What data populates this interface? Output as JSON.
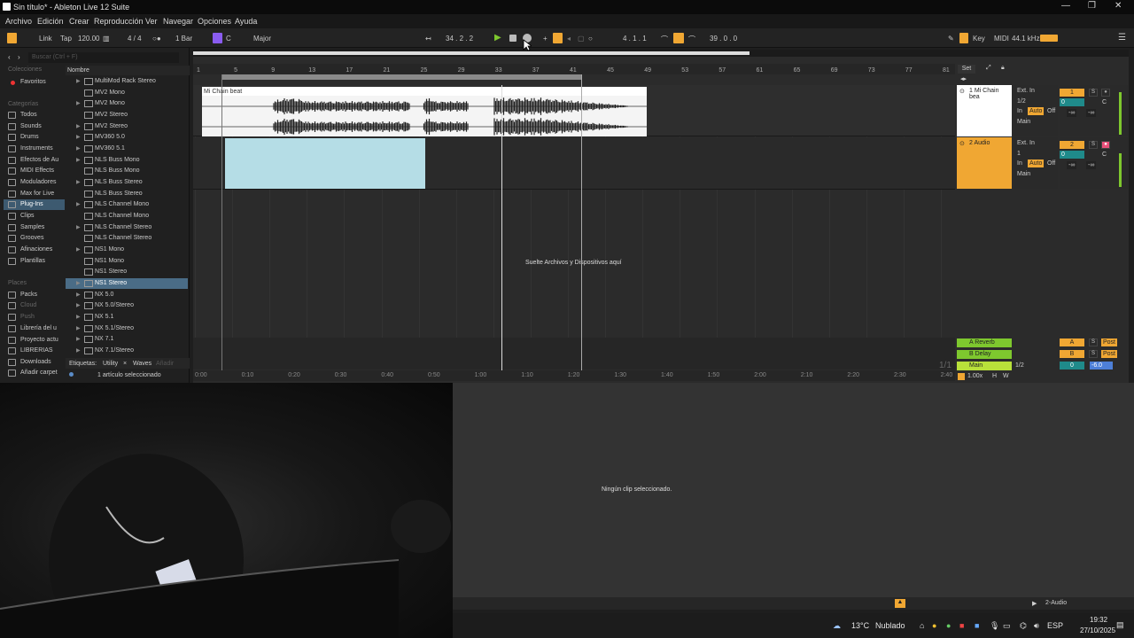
{
  "window": {
    "title": "Sin título* - Ableton Live 12 Suite",
    "minimize": "—",
    "restore": "❐",
    "close": "✕"
  },
  "menu": [
    "Archivo",
    "Edición",
    "Crear",
    "Reproducción",
    "Ver",
    "Navegar",
    "Opciones",
    "Ayuda"
  ],
  "control": {
    "link": "Link",
    "tap": "Tap",
    "tempo": "120.00",
    "signature": "4 / 4",
    "quantize": "1 Bar",
    "key": "C",
    "scale": "Major",
    "position": "34 .  2 .  2",
    "loop_start": "4 .  1 .  1",
    "loop_length": "39 .  0 .  0",
    "key_btn": "Key",
    "midi_btn": "MIDI",
    "sample_rate": "44.1 kHz"
  },
  "browser": {
    "search_placeholder": "Buscar (Ctrl + F)",
    "collections_header": "Colecciones",
    "favorites": "Favoritos",
    "categories_header": "Categorías",
    "categories": [
      "Todos",
      "Sounds",
      "Drums",
      "Instruments",
      "Efectos de Au",
      "MIDI Effects",
      "Moduladores",
      "Max for Live",
      "Plug-Ins",
      "Clips",
      "Samples",
      "Grooves",
      "Afinaciones",
      "Plantillas"
    ],
    "places_header": "Places",
    "places": [
      "Packs",
      "Cloud",
      "Push",
      "Librería del u",
      "Proyecto actu",
      "LIBRERIAS",
      "Downloads",
      "Añadir carpet"
    ],
    "name_header": "Nombre",
    "files": [
      "MultiMod Rack Stereo",
      "MV2 Mono",
      "MV2 Mono",
      "MV2 Stereo",
      "MV2 Stereo",
      "MV360 5.0",
      "MV360 5.1",
      "NLS Buss Mono",
      "NLS Buss Mono",
      "NLS Buss Stereo",
      "NLS Buss Stereo",
      "NLS Channel Mono",
      "NLS Channel Mono",
      "NLS Channel Stereo",
      "NLS Channel Stereo",
      "NS1 Mono",
      "NS1 Mono",
      "NS1 Stereo",
      "NS1 Stereo",
      "NX 5.0",
      "NX 5.0/Stereo",
      "NX 5.1",
      "NX 5.1/Stereo",
      "NX 7.1",
      "NX 7.1/Stereo"
    ],
    "tags_label": "Etiquetas:",
    "tag_utility": "Utility",
    "tag_waves": "Waves",
    "tag_add": "Añadir",
    "status": "1 artículo seleccionado"
  },
  "arrangement": {
    "bar_numbers": [
      "1",
      "5",
      "9",
      "13",
      "17",
      "21",
      "25",
      "29",
      "33",
      "37",
      "41",
      "45",
      "49",
      "53",
      "57",
      "61",
      "65",
      "69",
      "73",
      "77",
      "81"
    ],
    "time_labels": [
      "0:00",
      "0:10",
      "0:20",
      "0:30",
      "0:40",
      "0:50",
      "1:00",
      "1:10",
      "1:20",
      "1:30",
      "1:40",
      "1:50",
      "2:00",
      "2:10",
      "2:20",
      "2:30",
      "2:40"
    ],
    "clip_name": "Mi Chain beat",
    "drop_hint": "Suelte Archivos y Dispositivos aquí",
    "set_label": "Set",
    "page_count": "1/1",
    "zoom": "1.00x"
  },
  "tracks": [
    {
      "name": "1 Mi Chain bea",
      "input": "Ext. In",
      "channel": "1/2",
      "monitor_in": "In",
      "monitor_auto": "Auto",
      "monitor_off": "Off",
      "output": "Main",
      "number": "1",
      "solo": "S",
      "volume": "0",
      "pan": "C",
      "send_a": "-∞",
      "send_b": "-∞",
      "color": "#ffffff"
    },
    {
      "name": "2 Audio",
      "input": "Ext. In",
      "channel": "1",
      "monitor_in": "In",
      "monitor_auto": "Auto",
      "monitor_off": "Off",
      "output": "Main",
      "number": "2",
      "solo": "S",
      "volume": "0",
      "pan": "C",
      "send_a": "-∞",
      "send_b": "-∞",
      "color": "#f0a733"
    }
  ],
  "returns": [
    {
      "name": "A Reverb",
      "letter": "A",
      "solo": "S",
      "post": "Post"
    },
    {
      "name": "B Delay",
      "letter": "B",
      "solo": "S",
      "post": "Post"
    },
    {
      "name": "Main",
      "output": "1/2",
      "volume": "0",
      "meter": "-6.0"
    }
  ],
  "detail": {
    "empty": "Ningún clip seleccionado.",
    "track": "2-Audio"
  },
  "taskbar": {
    "temperature": "13°C",
    "weather": "Nublado",
    "lang": "ESP",
    "time": "19:32",
    "date": "27/10/2025"
  },
  "colors": {
    "accent": "#f0a733",
    "selection": "#4a6c86",
    "green": "#7ec82e",
    "clip_blue": "#b5dde6"
  }
}
